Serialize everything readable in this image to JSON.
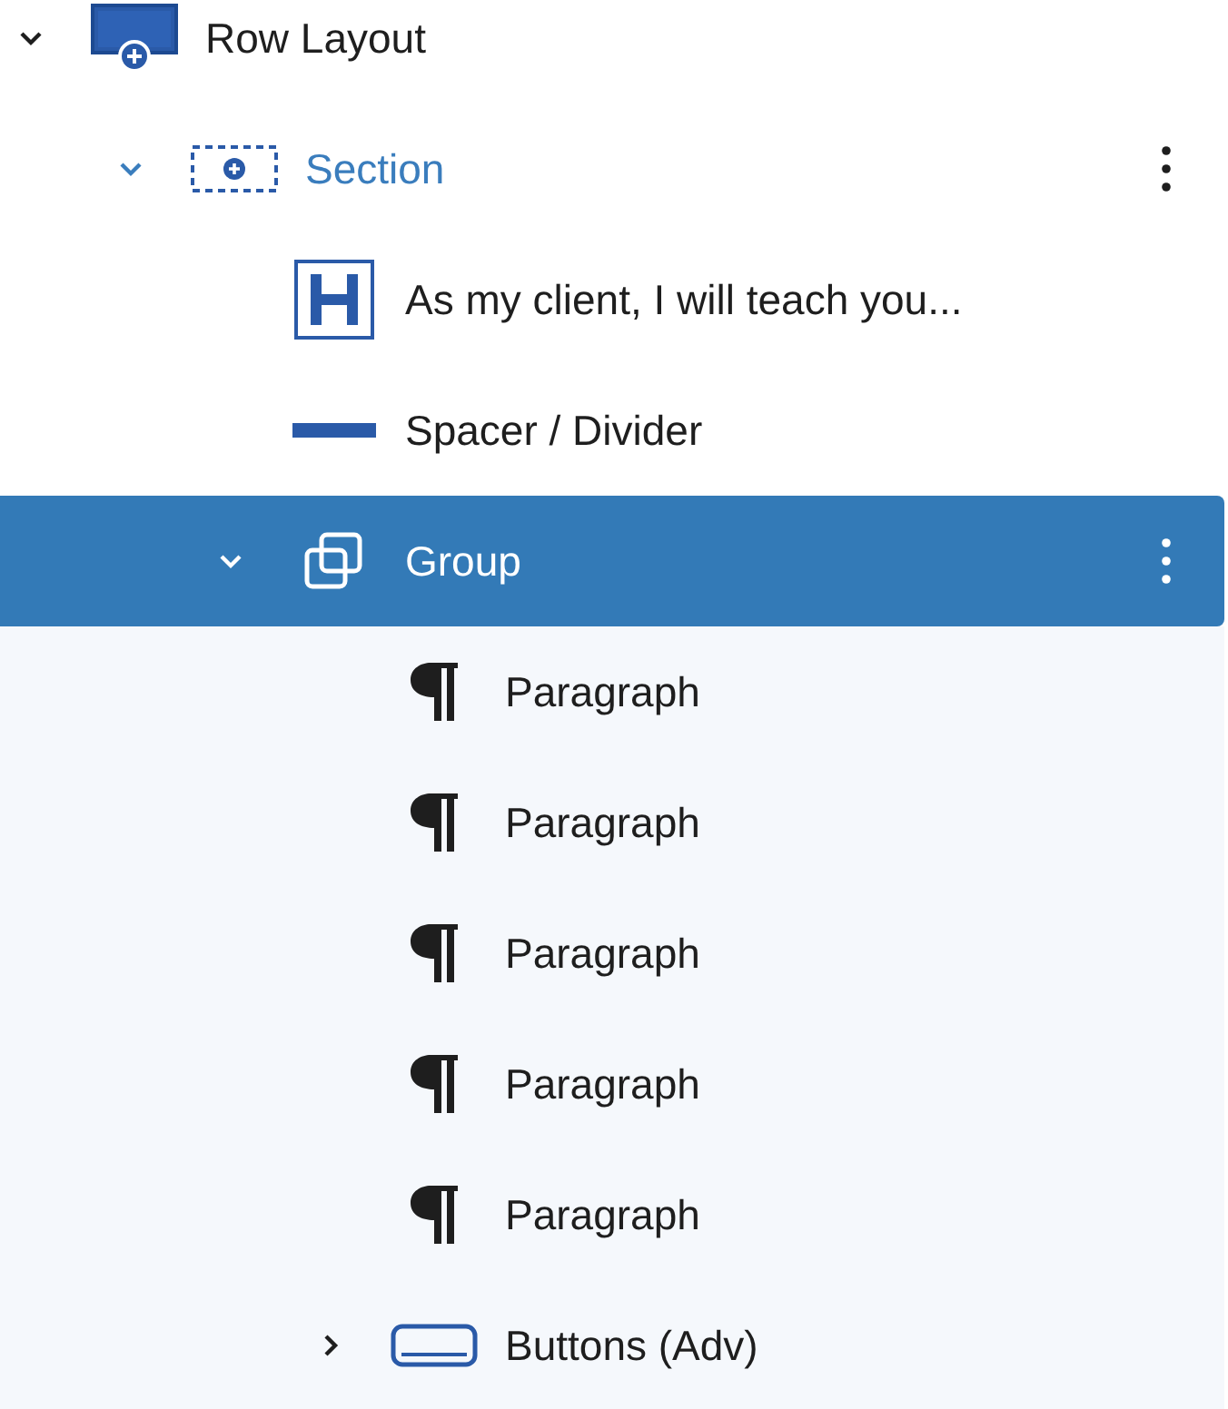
{
  "tree": [
    {
      "label": "Row Layout",
      "kind": "row",
      "expanded": true,
      "selected": false,
      "highlighted": false,
      "has_menu": false,
      "children": [
        {
          "label": "Section",
          "kind": "section",
          "expanded": true,
          "selected": false,
          "highlighted": true,
          "has_menu": true,
          "children": [
            {
              "label": "As my client, I will teach you...",
              "kind": "heading",
              "selected": false,
              "highlighted": false,
              "has_menu": false
            },
            {
              "label": "Spacer / Divider",
              "kind": "divider",
              "selected": false,
              "highlighted": false,
              "has_menu": false
            },
            {
              "label": "Group",
              "kind": "group",
              "expanded": true,
              "selected": true,
              "highlighted": false,
              "has_menu": true,
              "children": [
                {
                  "label": "Paragraph",
                  "kind": "paragraph",
                  "selected": false,
                  "highlighted": false,
                  "has_menu": false
                },
                {
                  "label": "Paragraph",
                  "kind": "paragraph",
                  "selected": false,
                  "highlighted": false,
                  "has_menu": false
                },
                {
                  "label": "Paragraph",
                  "kind": "paragraph",
                  "selected": false,
                  "highlighted": false,
                  "has_menu": false
                },
                {
                  "label": "Paragraph",
                  "kind": "paragraph",
                  "selected": false,
                  "highlighted": false,
                  "has_menu": false
                },
                {
                  "label": "Paragraph",
                  "kind": "paragraph",
                  "selected": false,
                  "highlighted": false,
                  "has_menu": false
                },
                {
                  "label": "Buttons (Adv)",
                  "kind": "buttons",
                  "expanded": false,
                  "selected": false,
                  "highlighted": false,
                  "has_menu": false
                }
              ]
            }
          ]
        }
      ]
    }
  ]
}
